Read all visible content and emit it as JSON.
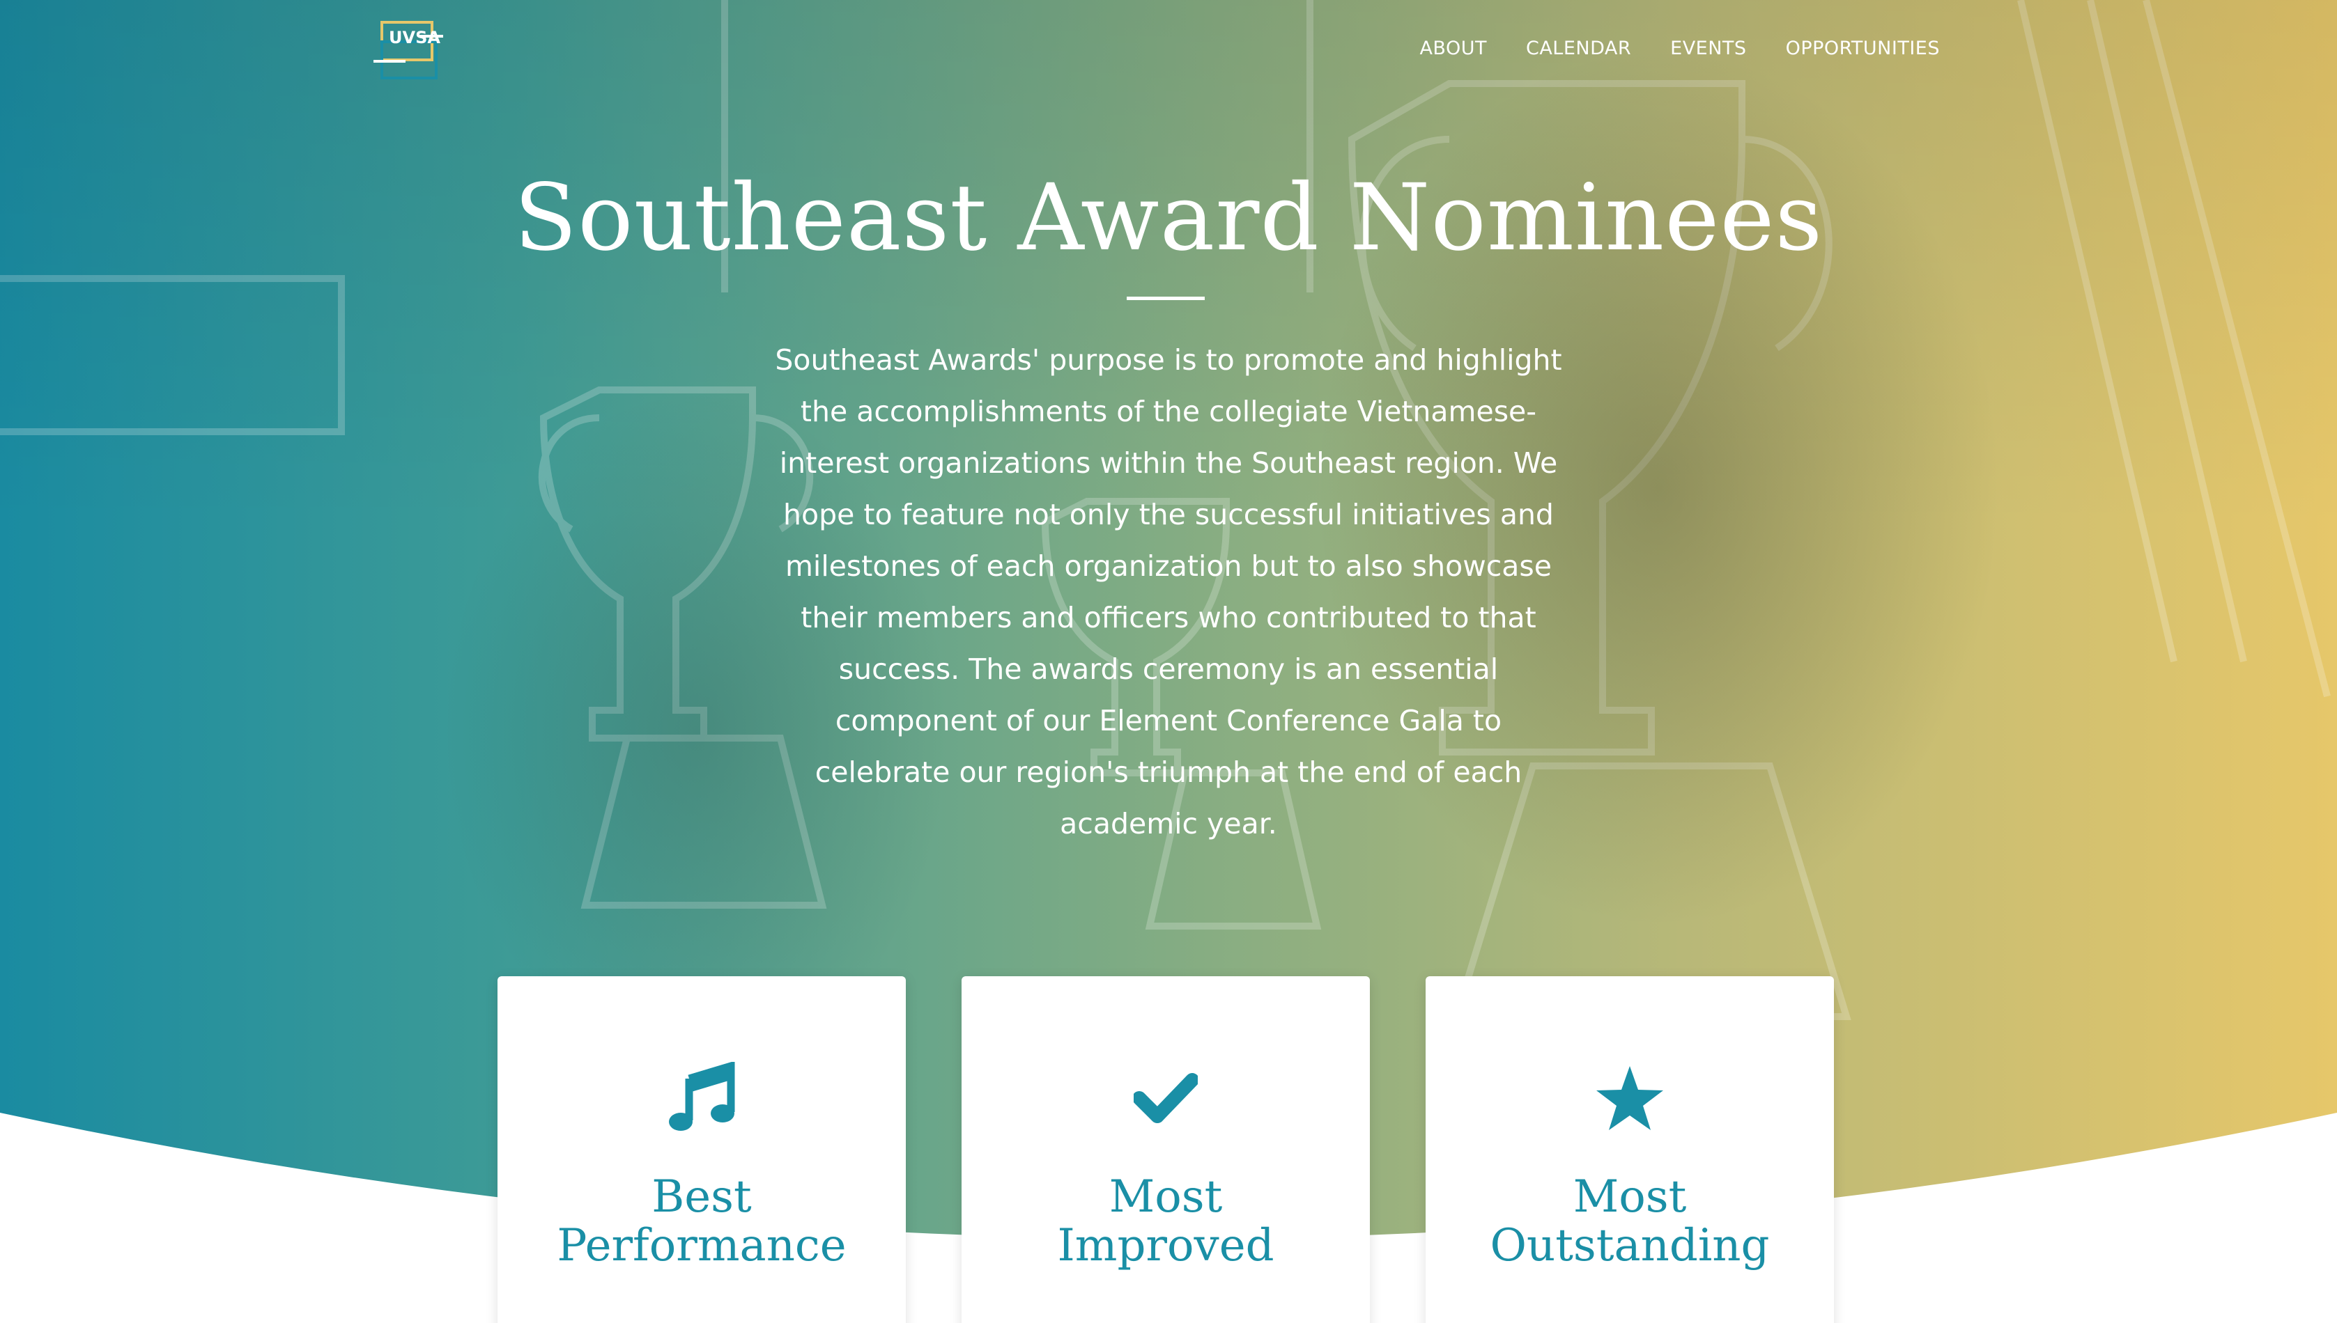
{
  "header": {
    "logo_text": "UVSA",
    "nav": [
      {
        "label": "ABOUT"
      },
      {
        "label": "CALENDAR"
      },
      {
        "label": "EVENTS"
      },
      {
        "label": "OPPORTUNITIES"
      }
    ]
  },
  "hero": {
    "title": "Southeast Award Nominees",
    "description": "Southeast Awards' purpose is to promote and highlight the accomplishments of the collegiate Vietnamese-interest organizations within the Southeast region. We hope to feature not only the successful initiatives and milestones of each organization but to also showcase their members and officers who contributed to that success. The awards ceremony is an essential component of our Element Conference Gala to celebrate our region's triumph at the end of each academic year."
  },
  "cards": [
    {
      "icon": "music-note-icon",
      "line1": "Best",
      "line2": "Performance"
    },
    {
      "icon": "checkmark-icon",
      "line1": "Most",
      "line2": "Improved"
    },
    {
      "icon": "star-icon",
      "line1": "Most",
      "line2": "Outstanding"
    }
  ],
  "colors": {
    "accent": "#1a8fa6",
    "gradient_left": "#1a8ba1",
    "gradient_right": "#e6c76a",
    "text_on_hero": "#ffffff"
  }
}
